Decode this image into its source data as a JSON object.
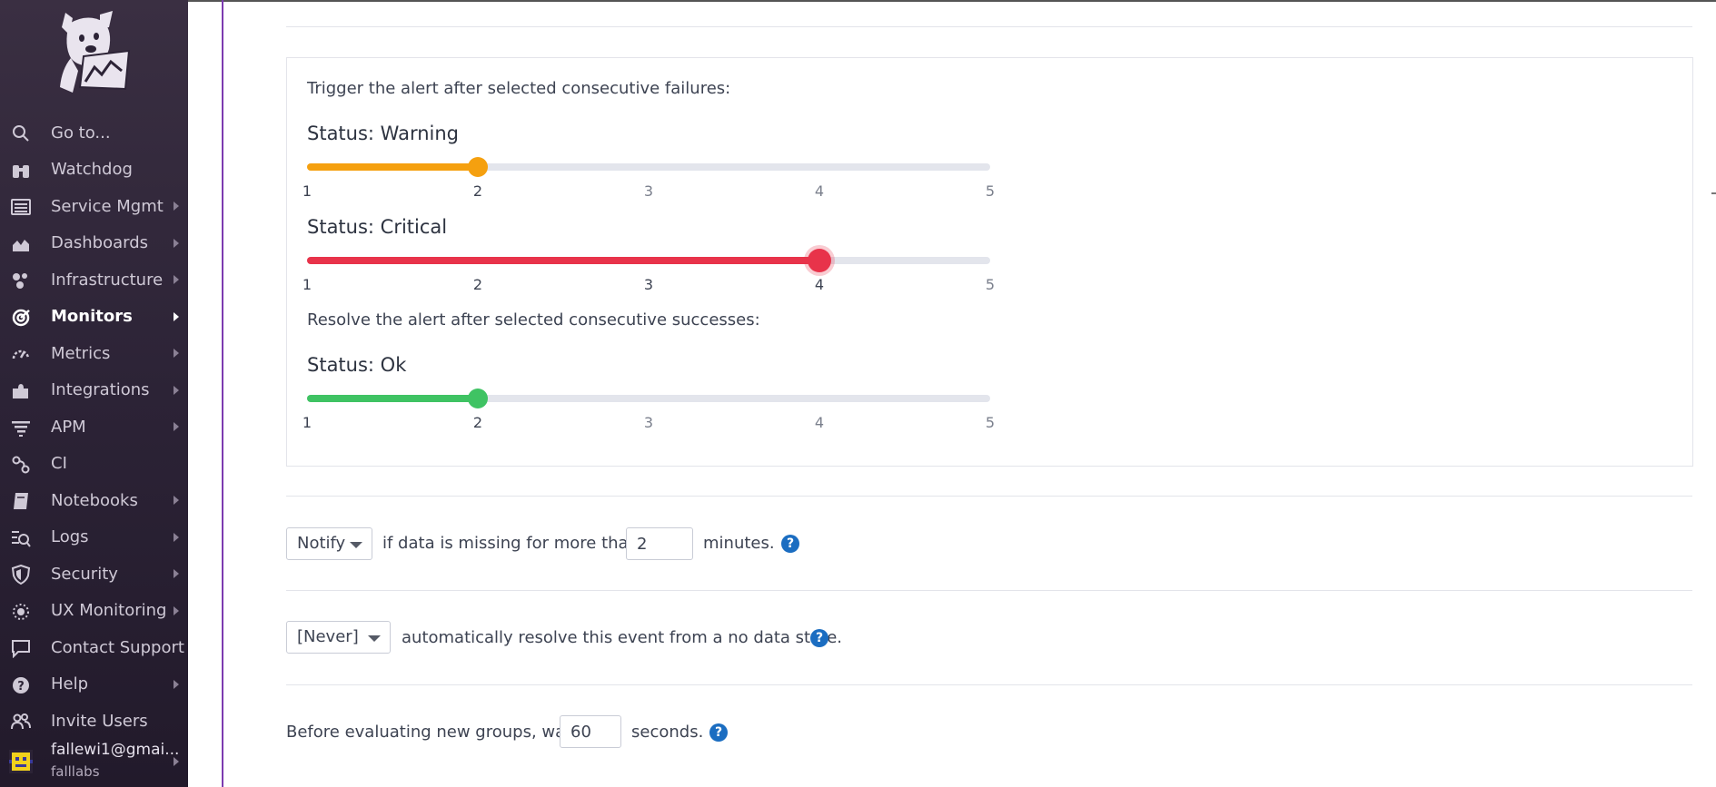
{
  "sidebar": {
    "items": [
      {
        "label": "Go to...",
        "icon": "search-icon",
        "caret": false
      },
      {
        "label": "Watchdog",
        "icon": "binoculars-icon",
        "caret": false
      },
      {
        "label": "Service Mgmt",
        "icon": "service-list-icon",
        "caret": true
      },
      {
        "label": "Dashboards",
        "icon": "area-chart-icon",
        "caret": true
      },
      {
        "label": "Infrastructure",
        "icon": "hexagons-icon",
        "caret": true
      },
      {
        "label": "Monitors",
        "icon": "target-icon",
        "caret": true,
        "active": true
      },
      {
        "label": "Metrics",
        "icon": "gauge-icon",
        "caret": true
      },
      {
        "label": "Integrations",
        "icon": "puzzle-icon",
        "caret": true
      },
      {
        "label": "APM",
        "icon": "apm-bars-icon",
        "caret": true
      },
      {
        "label": "CI",
        "icon": "pipeline-icon",
        "caret": false
      },
      {
        "label": "Notebooks",
        "icon": "notebook-icon",
        "caret": true
      },
      {
        "label": "Logs",
        "icon": "logs-icon",
        "caret": true
      },
      {
        "label": "Security",
        "icon": "shield-icon",
        "caret": true
      },
      {
        "label": "UX Monitoring",
        "icon": "ux-monitoring-icon",
        "caret": true
      },
      {
        "label": "Contact Support",
        "icon": "chat-bubble-icon",
        "caret": false
      },
      {
        "label": "Help",
        "icon": "question-circle-icon",
        "caret": true
      },
      {
        "label": "Invite Users",
        "icon": "users-icon",
        "caret": false
      }
    ],
    "user": {
      "email": "fallewi1@gmai...",
      "org": "falllabs"
    }
  },
  "alert": {
    "trigger_text": "Trigger the alert after selected consecutive failures:",
    "warning": {
      "label": "Status: Warning",
      "value": 2,
      "color": "#f5a00f"
    },
    "critical": {
      "label": "Status: Critical",
      "value": 4,
      "color": "#e8334a"
    },
    "resolve_text": "Resolve the alert after selected consecutive successes:",
    "ok": {
      "label": "Status: Ok",
      "value": 2,
      "color": "#3fc363"
    },
    "ticks": [
      "1",
      "2",
      "3",
      "4",
      "5"
    ]
  },
  "nodata": {
    "select": "Notify",
    "text1": "if data is missing for more than",
    "minutes": "2",
    "text2": "minutes."
  },
  "autoresolve": {
    "select": "[Never]",
    "text": "automatically resolve this event from a no data state."
  },
  "newgroups": {
    "text1": "Before evaluating new groups, wait",
    "seconds": "60",
    "text2": "seconds."
  },
  "help_glyph": "?"
}
